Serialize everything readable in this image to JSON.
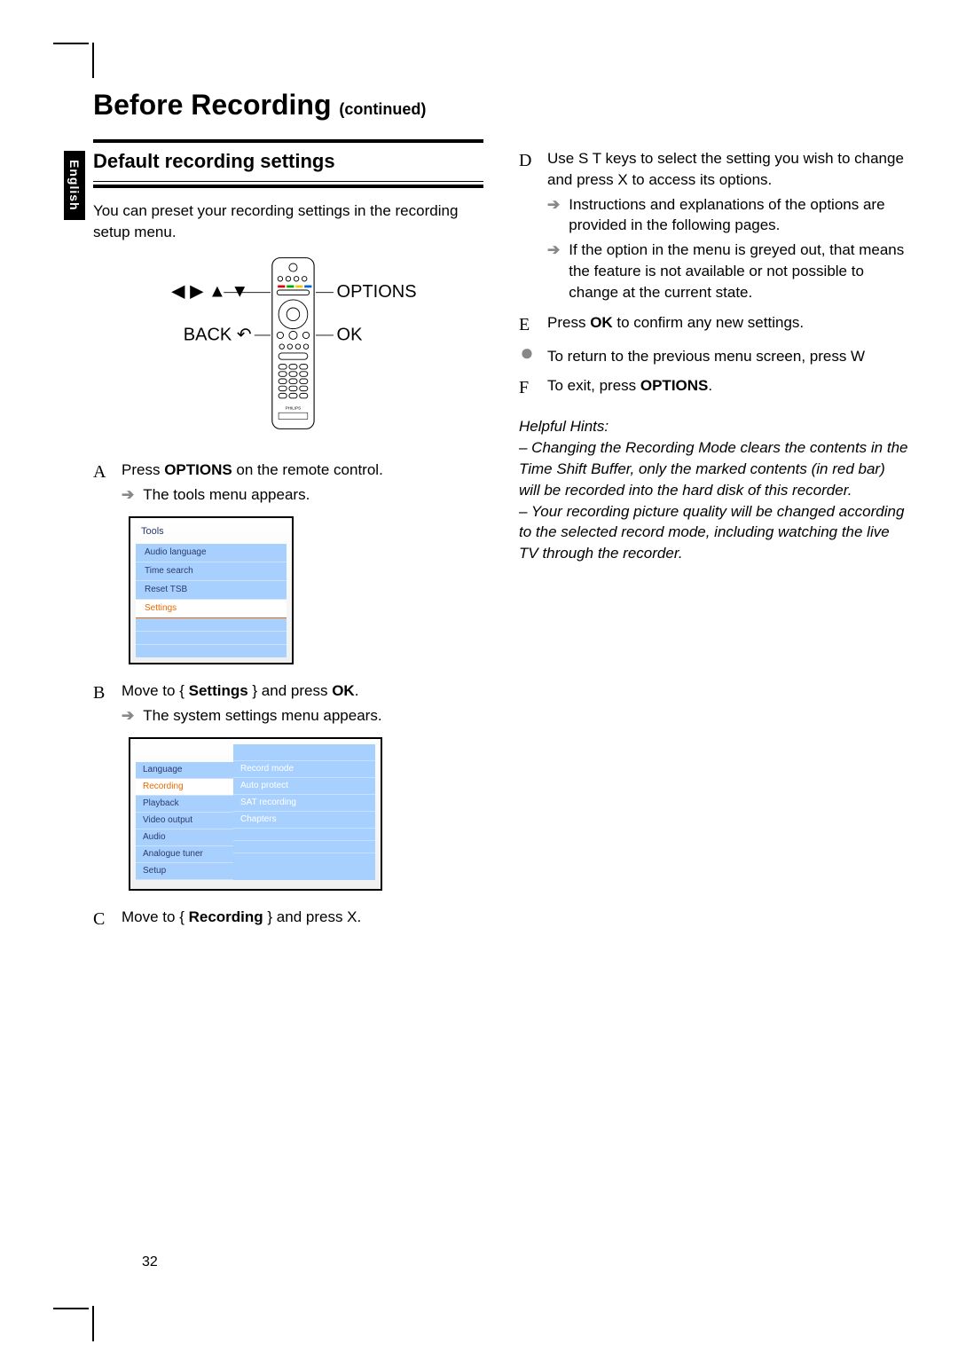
{
  "language_tab": "English",
  "title_main": "Before Recording",
  "title_cont": "(continued)",
  "section_heading": "Default recording settings",
  "intro_text": "You can preset your recording settings in the recording setup menu.",
  "remote_labels": {
    "arrows": "◀ ▶ ▲ ▼",
    "options": "OPTIONS",
    "back": "BACK",
    "ok": "OK"
  },
  "steps": {
    "A": {
      "letter": "A",
      "text_prefix": "Press ",
      "text_bold": "OPTIONS",
      "text_suffix": " on the remote control.",
      "sub_arrow": "The tools menu appears."
    },
    "B": {
      "letter": "B",
      "text_prefix": "Move to { ",
      "text_bold": "Settings",
      "text_mid": " } and press ",
      "text_bold2": "OK",
      "text_suffix": ".",
      "sub_arrow": "The system settings menu appears."
    },
    "C": {
      "letter": "C",
      "text_prefix": "Move to { ",
      "text_bold": "Recording",
      "text_suffix": " } and press  X."
    },
    "D": {
      "letter": "D",
      "line1": "Use  S T  keys to select the setting you wish to change and press  X to access its options.",
      "sub1": "Instructions and explanations of the options are provided in the following pages.",
      "sub2": "If the option in the menu is greyed out, that means the feature is not available or not possible to change at the current state."
    },
    "E": {
      "letter": "E",
      "prefix": "Press ",
      "bold": "OK",
      "suffix": " to confirm any new settings."
    },
    "bullet": "To return to the previous menu screen, press  W",
    "F": {
      "letter": "F",
      "prefix": "To exit, press ",
      "bold": "OPTIONS",
      "suffix": "."
    }
  },
  "tools_menu": {
    "title": "Tools",
    "items": [
      "Audio language",
      "Time search",
      "Reset TSB",
      "Settings"
    ],
    "selected": "Settings"
  },
  "settings_menu": {
    "left_header": "",
    "left_items": [
      "Language",
      "Recording",
      "Playback",
      "Video output",
      "Audio",
      "Analogue tuner",
      "Setup"
    ],
    "left_selected": "Recording",
    "right_items": [
      "Record mode",
      "Auto protect",
      "SAT recording",
      "Chapters"
    ]
  },
  "hints": {
    "heading": "Helpful Hints:",
    "h1": "– Changing the Recording Mode clears the contents in the Time Shift Buffer, only the marked contents (in red bar) will be recorded into the hard disk of this recorder.",
    "h2": "– Your recording picture quality will be changed according to the selected record mode, including watching the live TV through the recorder."
  },
  "page_number": "32"
}
